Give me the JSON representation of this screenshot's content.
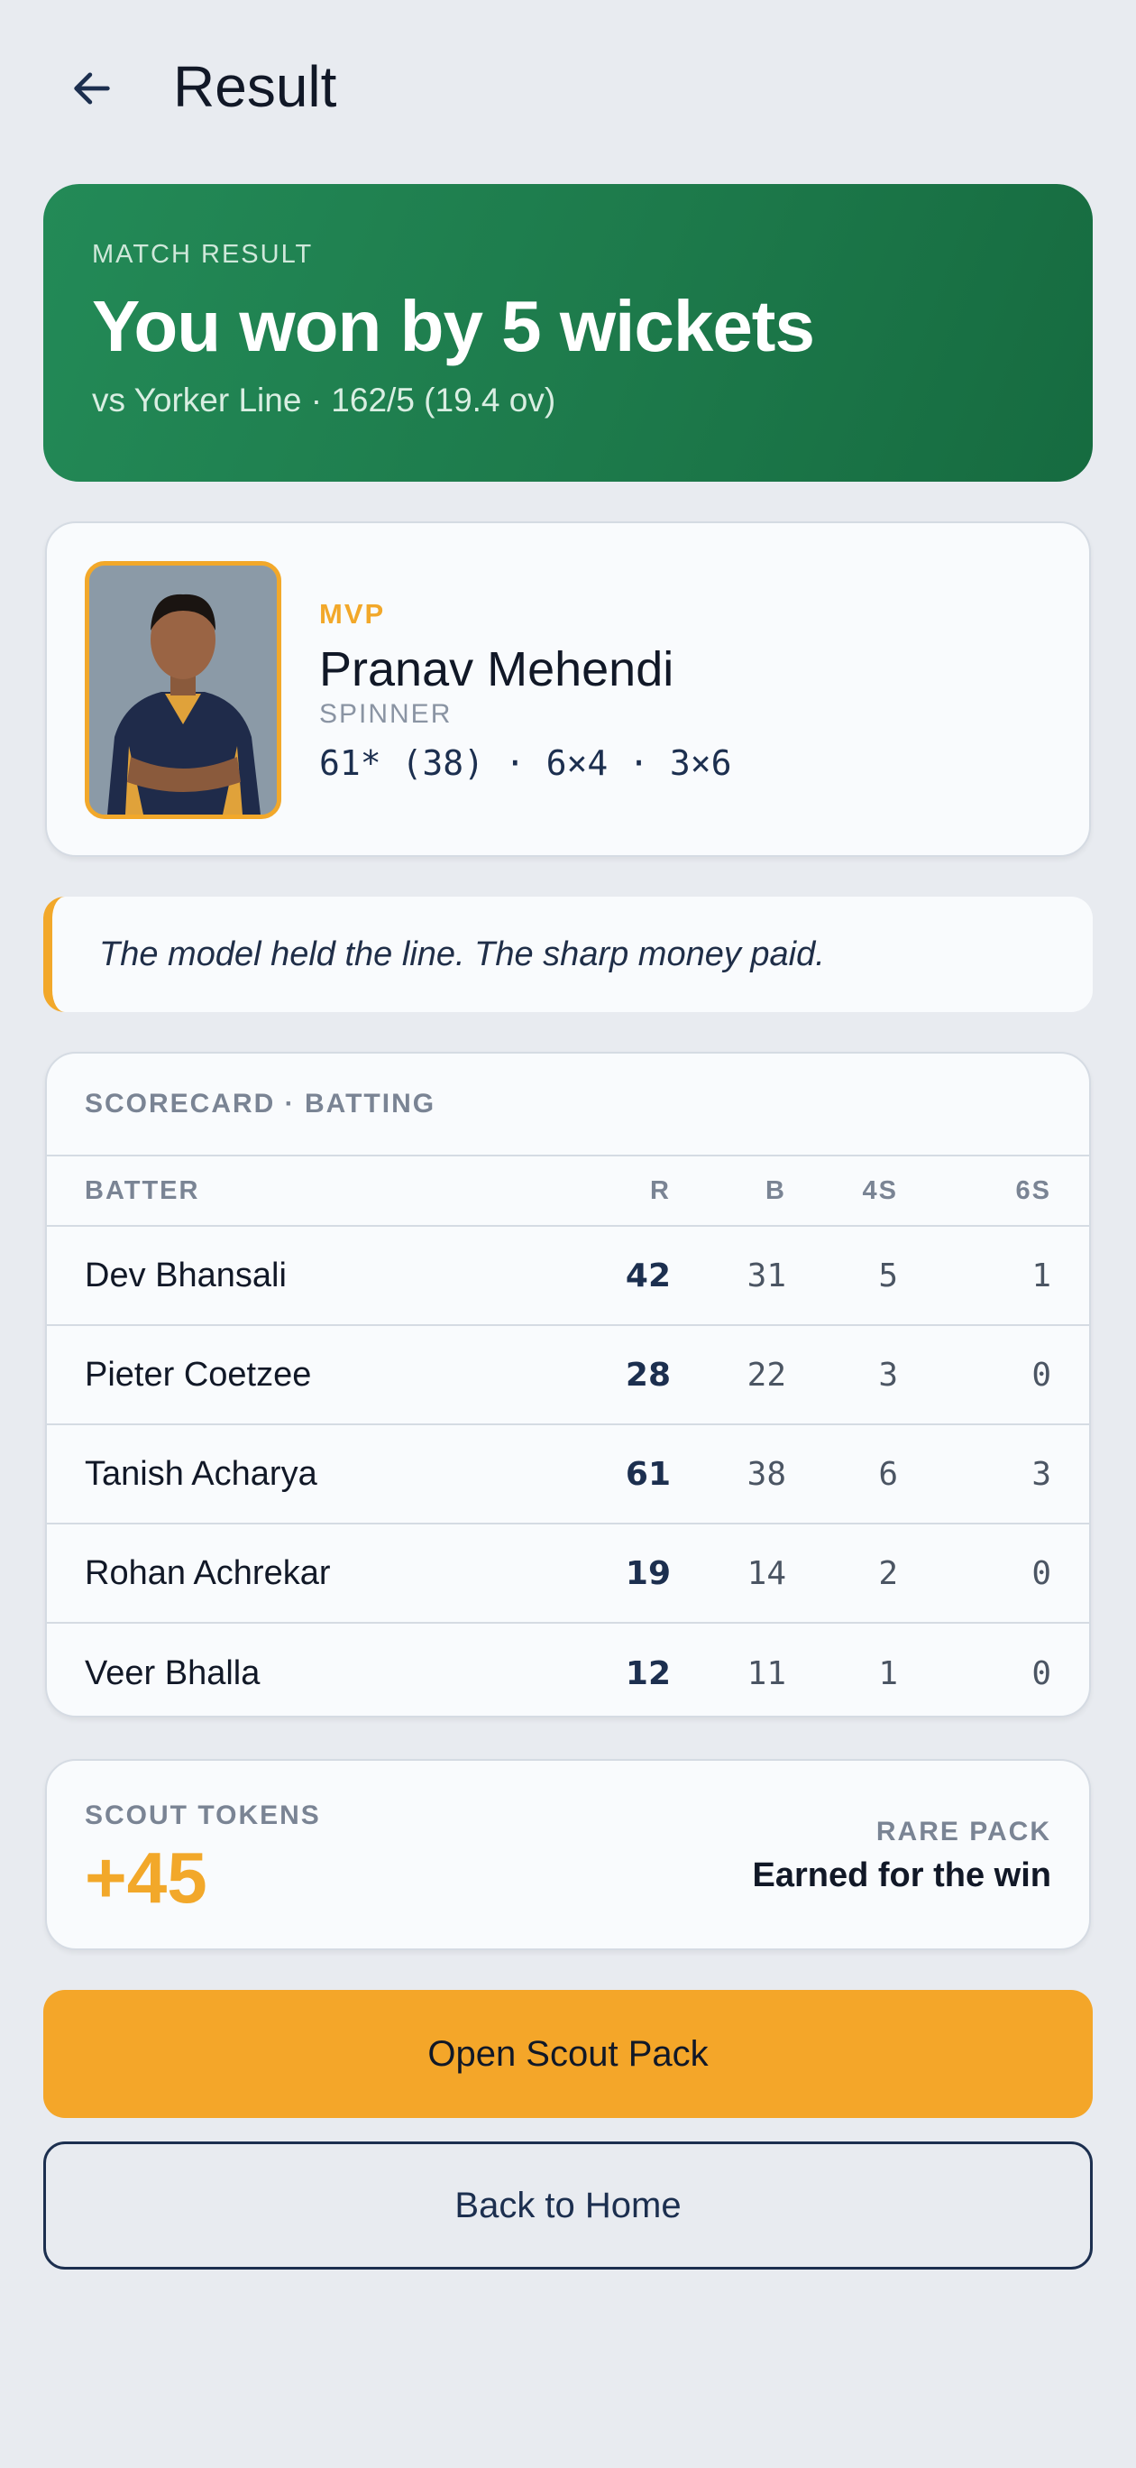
{
  "header": {
    "title": "Result",
    "back_icon": "arrow-left-icon"
  },
  "hero": {
    "eyebrow": "MATCH RESULT",
    "headline": "You won by 5 wickets",
    "subline": "vs Yorker Line · 162/5 (19.4 ov)",
    "colors": {
      "gradient_start": "#238a57",
      "gradient_end": "#166b40"
    }
  },
  "mvp": {
    "label": "MVP",
    "name": "Pranav Mehendi",
    "role": "SPINNER",
    "stats": "61* (38) · 6×4 · 3×6",
    "photo_icon": "player-portrait",
    "accent": "#f2a82a"
  },
  "quote": {
    "text": "The model held the line. The sharp money paid."
  },
  "scorecard": {
    "title": "SCORECARD · BATTING",
    "columns": [
      "BATTER",
      "R",
      "B",
      "4S",
      "6S"
    ],
    "rows": [
      {
        "name": "Dev Bhansali",
        "r": "42",
        "b": "31",
        "fours": "5",
        "sixes": "1"
      },
      {
        "name": "Pieter Coetzee",
        "r": "28",
        "b": "22",
        "fours": "3",
        "sixes": "0"
      },
      {
        "name": "Tanish Acharya",
        "r": "61",
        "b": "38",
        "fours": "6",
        "sixes": "3"
      },
      {
        "name": "Rohan Achrekar",
        "r": "19",
        "b": "14",
        "fours": "2",
        "sixes": "0"
      },
      {
        "name": "Veer Bhalla",
        "r": "12",
        "b": "11",
        "fours": "1",
        "sixes": "0"
      }
    ]
  },
  "tokens": {
    "label": "SCOUT TOKENS",
    "value": "+45",
    "pack": "RARE PACK",
    "note": "Earned for the win"
  },
  "actions": {
    "primary": "Open Scout Pack",
    "secondary": "Back to Home",
    "primary_color": "#f4a629"
  }
}
